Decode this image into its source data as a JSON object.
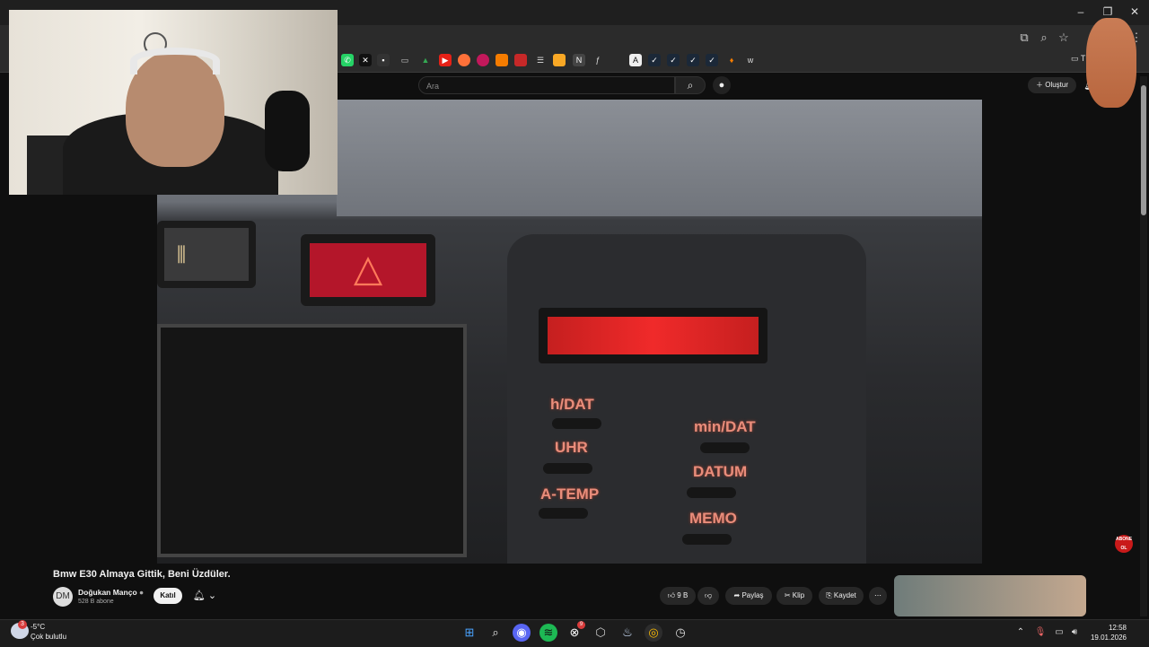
{
  "browser": {
    "window_controls": [
      "–",
      "❐",
      "✕"
    ],
    "bookmarks_folder_label": "Tü",
    "bookmark_icons": [
      "whatsapp",
      "x",
      "folder",
      "drive",
      "youtube",
      "firefox",
      "gitlab",
      "chrome",
      "gmail",
      "db",
      "game",
      "notion",
      "feedly",
      "a",
      "steam",
      "steam",
      "steam",
      "steam",
      "flame",
      "w"
    ],
    "toolbar_icons": [
      "cast-icon",
      "zoom-icon",
      "star-icon",
      "menu-icon"
    ]
  },
  "youtube": {
    "search_placeholder": "Ara",
    "create_label": "Oluştur",
    "video_title": "Bmw E30 Almaya Gittik, Beni Üzdüler.",
    "channel_name": "Doğukan Manço",
    "channel_avatar_text": "DM",
    "subscribers": "528 B abone",
    "join_label": "Katıl",
    "likes": "9 B",
    "share_label": "Paylaş",
    "clip_label": "Klip",
    "save_label": "Kaydet",
    "more_label": "⋯",
    "abone_badge": "ABONE OL"
  },
  "video_frame": {
    "display_color": "#e52a2a",
    "labels_left": [
      "h/DAT",
      "UHR",
      "A-TEMP"
    ],
    "labels_right": [
      "min/DAT",
      "DATUM",
      "MEMO"
    ]
  },
  "taskbar": {
    "weather_badge": "3",
    "temperature": "-5°C",
    "condition": "Çok bulutlu",
    "time": "12:58",
    "date": "19.01.2026",
    "apps": [
      "windows",
      "search",
      "discord",
      "spotify",
      "xbox",
      "app",
      "steam",
      "chrome",
      "clock"
    ],
    "xbox_badge": "9"
  }
}
